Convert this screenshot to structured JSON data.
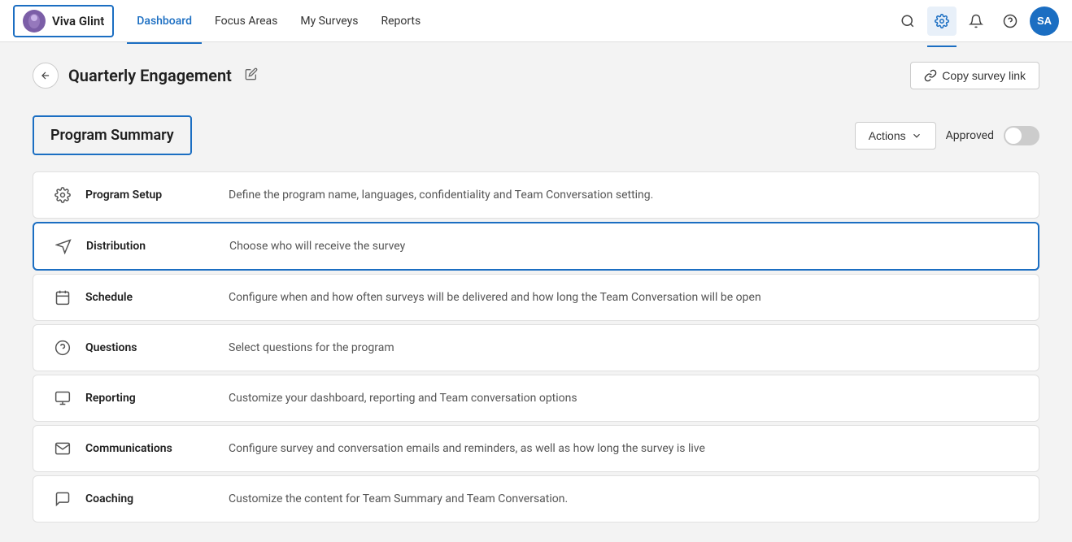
{
  "nav": {
    "brand_name": "Viva Glint",
    "links": [
      {
        "label": "Dashboard",
        "active": true
      },
      {
        "label": "Focus Areas",
        "active": false
      },
      {
        "label": "My Surveys",
        "active": false
      },
      {
        "label": "Reports",
        "active": false
      }
    ],
    "avatar_initials": "SA",
    "copy_survey_link_label": "Copy survey link"
  },
  "page": {
    "title": "Quarterly Engagement",
    "section_title": "Program Summary",
    "actions_label": "Actions",
    "approved_label": "Approved"
  },
  "menu_items": [
    {
      "name": "Program Setup",
      "description": "Define the program name, languages, confidentiality and Team Conversation setting.",
      "icon": "settings",
      "selected": false
    },
    {
      "name": "Distribution",
      "description": "Choose who will receive the survey",
      "icon": "distribution",
      "selected": true
    },
    {
      "name": "Schedule",
      "description": "Configure when and how often surveys will be delivered and how long the Team Conversation will be open",
      "icon": "schedule",
      "selected": false
    },
    {
      "name": "Questions",
      "description": "Select questions for the program",
      "icon": "questions",
      "selected": false
    },
    {
      "name": "Reporting",
      "description": "Customize your dashboard, reporting and Team conversation options",
      "icon": "reporting",
      "selected": false
    },
    {
      "name": "Communications",
      "description": "Configure survey and conversation emails and reminders, as well as how long the survey is live",
      "icon": "communications",
      "selected": false
    },
    {
      "name": "Coaching",
      "description": "Customize the content for Team Summary and Team Conversation.",
      "icon": "coaching",
      "selected": false
    }
  ]
}
